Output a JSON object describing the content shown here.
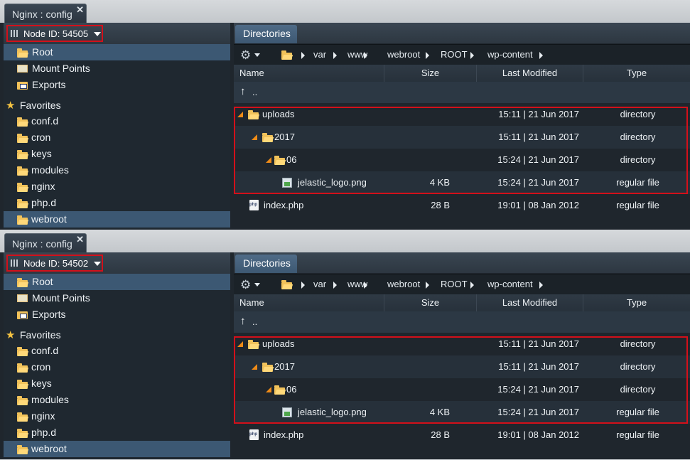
{
  "panels": [
    {
      "tab_title": "Nginx : config",
      "close_glyph": "✕",
      "node_label": "Node ID: 54505",
      "sidebar": [
        {
          "label": "Root",
          "icon": "folder-open-icon",
          "selected": true
        },
        {
          "label": "Mount Points",
          "icon": "mount-icon",
          "selected": false
        },
        {
          "label": "Exports",
          "icon": "export-icon",
          "selected": false
        },
        {
          "label": "Favorites",
          "icon": "star-icon",
          "selected": false
        },
        {
          "label": "conf.d",
          "icon": "folder-icon",
          "selected": false
        },
        {
          "label": "cron",
          "icon": "folder-icon",
          "selected": false
        },
        {
          "label": "keys",
          "icon": "folder-icon",
          "selected": false
        },
        {
          "label": "modules",
          "icon": "folder-icon",
          "selected": false
        },
        {
          "label": "nginx",
          "icon": "folder-icon",
          "selected": false
        },
        {
          "label": "php.d",
          "icon": "folder-icon",
          "selected": false
        },
        {
          "label": "webroot",
          "icon": "folder-icon",
          "selected": true
        }
      ],
      "dir_tab": "Directories",
      "breadcrumb": [
        "var",
        "www",
        "webroot",
        "ROOT",
        "wp-content"
      ],
      "columns": {
        "name": "Name",
        "size": "Size",
        "modified": "Last Modified",
        "type": "Type"
      },
      "up_label": "..",
      "files": [
        {
          "name": "uploads",
          "size": "",
          "modified": "15:11 | 21 Jun 2017",
          "type": "directory",
          "icon": "folder-icon"
        },
        {
          "name": "2017",
          "size": "",
          "modified": "15:11 | 21 Jun 2017",
          "type": "directory",
          "icon": "folder-icon"
        },
        {
          "name": "06",
          "size": "",
          "modified": "15:24 | 21 Jun 2017",
          "type": "directory",
          "icon": "folder-icon"
        },
        {
          "name": "jelastic_logo.png",
          "size": "4 KB",
          "modified": "15:24 | 21 Jun 2017",
          "type": "regular file",
          "icon": "image-file-icon"
        },
        {
          "name": "index.php",
          "size": "28 B",
          "modified": "19:01 | 08 Jan 2012",
          "type": "regular file",
          "icon": "php-file-icon"
        }
      ]
    },
    {
      "tab_title": "Nginx : config",
      "close_glyph": "✕",
      "node_label": "Node ID: 54502",
      "sidebar": [
        {
          "label": "Root",
          "icon": "folder-open-icon",
          "selected": true
        },
        {
          "label": "Mount Points",
          "icon": "mount-icon",
          "selected": false
        },
        {
          "label": "Exports",
          "icon": "export-icon",
          "selected": false
        },
        {
          "label": "Favorites",
          "icon": "star-icon",
          "selected": false
        },
        {
          "label": "conf.d",
          "icon": "folder-icon",
          "selected": false
        },
        {
          "label": "cron",
          "icon": "folder-icon",
          "selected": false
        },
        {
          "label": "keys",
          "icon": "folder-icon",
          "selected": false
        },
        {
          "label": "modules",
          "icon": "folder-icon",
          "selected": false
        },
        {
          "label": "nginx",
          "icon": "folder-icon",
          "selected": false
        },
        {
          "label": "php.d",
          "icon": "folder-icon",
          "selected": false
        },
        {
          "label": "webroot",
          "icon": "folder-icon",
          "selected": true
        }
      ],
      "dir_tab": "Directories",
      "breadcrumb": [
        "var",
        "www",
        "webroot",
        "ROOT",
        "wp-content"
      ],
      "columns": {
        "name": "Name",
        "size": "Size",
        "modified": "Last Modified",
        "type": "Type"
      },
      "up_label": "..",
      "files": [
        {
          "name": "uploads",
          "size": "",
          "modified": "15:11 | 21 Jun 2017",
          "type": "directory",
          "icon": "folder-icon"
        },
        {
          "name": "2017",
          "size": "",
          "modified": "15:11 | 21 Jun 2017",
          "type": "directory",
          "icon": "folder-icon"
        },
        {
          "name": "06",
          "size": "",
          "modified": "15:24 | 21 Jun 2017",
          "type": "directory",
          "icon": "folder-icon"
        },
        {
          "name": "jelastic_logo.png",
          "size": "4 KB",
          "modified": "15:24 | 21 Jun 2017",
          "type": "regular file",
          "icon": "image-file-icon"
        },
        {
          "name": "index.php",
          "size": "28 B",
          "modified": "19:01 | 08 Jan 2012",
          "type": "regular file",
          "icon": "php-file-icon"
        }
      ]
    }
  ],
  "colors": {
    "highlight": "#d3101a",
    "selected_row": "#3c5873",
    "expander": "#ef8b17"
  }
}
